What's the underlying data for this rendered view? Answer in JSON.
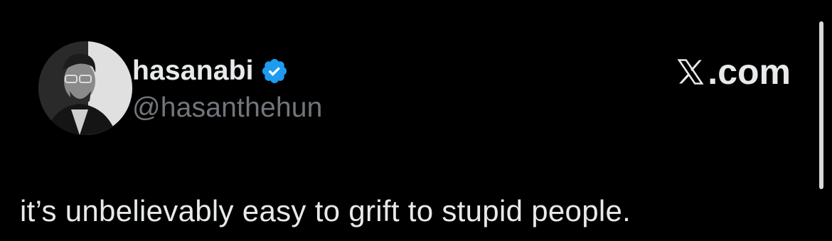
{
  "author": {
    "display_name": "hasanabi",
    "handle": "@hasanthehun",
    "verified": true,
    "verified_icon": "verified-badge-icon",
    "verified_color": "#1d9bf0"
  },
  "brand": {
    "label": ".com",
    "icon": "x-logo-icon"
  },
  "tweet": {
    "text": "it’s unbelievably easy to grift to stupid people."
  },
  "colors": {
    "background": "#000000",
    "primary_text": "#e7e9ea",
    "secondary_text": "#71767b"
  }
}
